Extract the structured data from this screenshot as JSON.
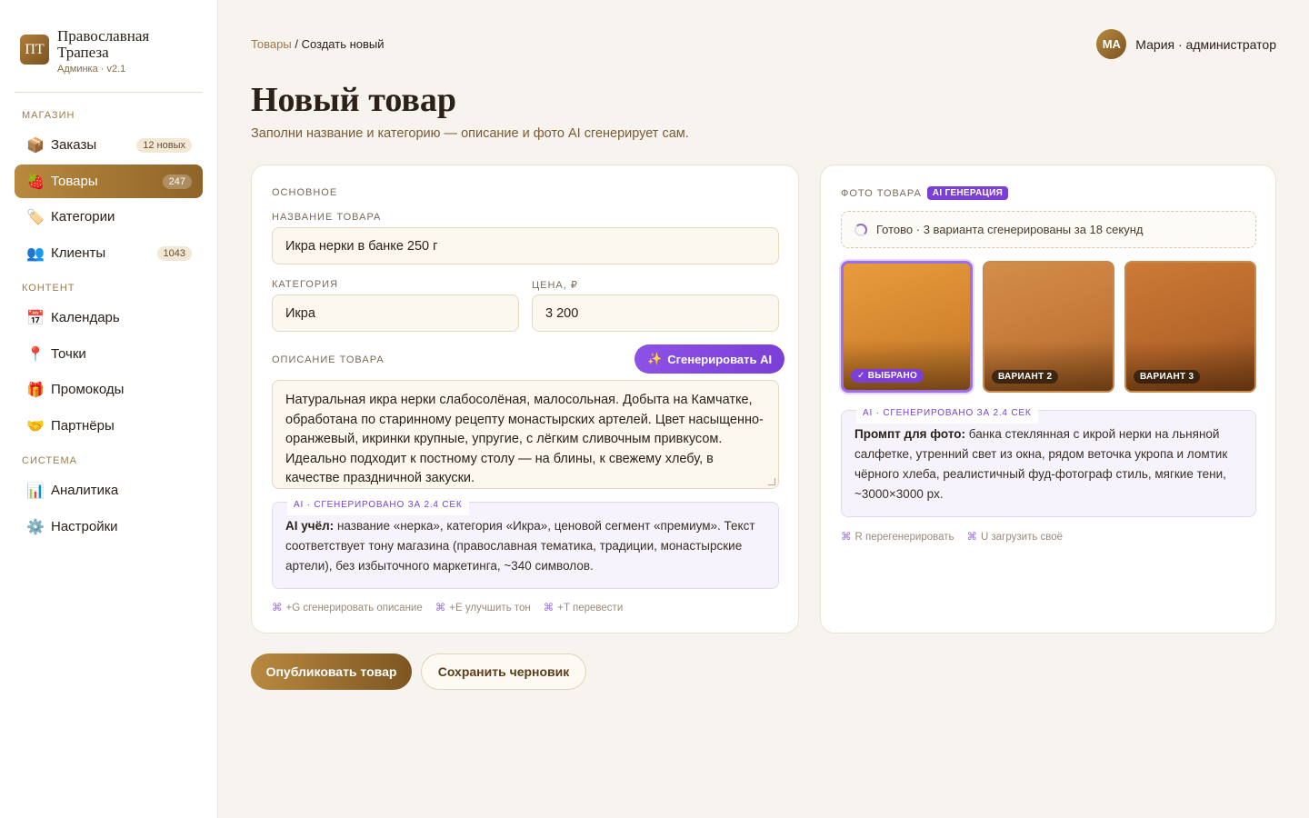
{
  "brand": {
    "logo_text": "ПТ",
    "name": "Православная Трапеза",
    "subtitle": "Админка · v2.1"
  },
  "sidebar": {
    "sections": [
      {
        "title": "Магазин"
      },
      {
        "title": "Контент"
      },
      {
        "title": "Система"
      }
    ],
    "items": [
      {
        "icon": "📦",
        "label": "Заказы",
        "badge": "12 новых"
      },
      {
        "icon": "🍓",
        "label": "Товары",
        "badge": "247",
        "active": true
      },
      {
        "icon": "🏷️",
        "label": "Категории",
        "badge": ""
      },
      {
        "icon": "👥",
        "label": "Клиенты",
        "badge": "1043"
      },
      {
        "icon": "📅",
        "label": "Календарь",
        "badge": ""
      },
      {
        "icon": "📍",
        "label": "Точки",
        "badge": ""
      },
      {
        "icon": "🎁",
        "label": "Промокоды",
        "badge": ""
      },
      {
        "icon": "🤝",
        "label": "Партнёры",
        "badge": ""
      },
      {
        "icon": "📊",
        "label": "Аналитика",
        "badge": ""
      },
      {
        "icon": "⚙️",
        "label": "Настройки",
        "badge": ""
      }
    ]
  },
  "header": {
    "breadcrumb_link": "Товары",
    "breadcrumb_sep": " / ",
    "breadcrumb_current": "Создать новый",
    "user_initials": "МА",
    "user_name": "Мария · администратор"
  },
  "page": {
    "title": "Новый товар",
    "subtitle": "Заполни название и категорию — описание и фото AI сгенерирует сам."
  },
  "form": {
    "section_title": "Основное",
    "name_label": "Название товара",
    "name_value": "Икра нерки в банке 250 г",
    "category_label": "Категория",
    "category_value": "Икра",
    "price_label": "Цена, ₽",
    "price_value": "3 200",
    "description_label": "Описание товара",
    "generate_button": "Сгенерировать AI",
    "description_value": "Натуральная икра нерки слабосолёная, малосольная. Добыта на Камчатке, обработана по старинному рецепту монастырских артелей. Цвет насыщенно-оранжевый, икринки крупные, упругие, с лёгким сливочным привкусом. Идеально подходит к постному столу — на блины, к свежему хлебу, в качестве праздничной закуски.",
    "ai_tag": "AI · сгенерировано за 2.4 сек",
    "ai_note_bold": "AI учёл:",
    "ai_note_text": " название «нерка», категория «Икра», ценовой сегмент «премиум». Текст соответствует тону магазина (православная тематика, традиции, монастырские артели), без избыточного маркетинга, ~340 символов.",
    "shortcuts": [
      {
        "key": "⌘",
        "text": "+G сгенерировать описание"
      },
      {
        "key": "⌘",
        "text": "+E улучшить тон"
      },
      {
        "key": "⌘",
        "text": "+T перевести"
      }
    ]
  },
  "photo": {
    "section_title": "Фото товара",
    "badge": "AI ГЕНЕРАЦИЯ",
    "status": "Готово · 3 варианта сгенерированы за 18 секунд",
    "variants": [
      {
        "label": "✓ ВЫБРАНО",
        "selected": true
      },
      {
        "label": "ВАРИАНТ 2",
        "selected": false
      },
      {
        "label": "ВАРИАНТ 3",
        "selected": false
      }
    ],
    "ai_tag": "AI · сгенерировано за 2.4 сек",
    "prompt_bold": "Промпт для фото:",
    "prompt_text": " банка стеклянная с икрой нерки на льняной салфетке, утренний свет из окна, рядом веточка укропа и ломтик чёрного хлеба, реалистичный фуд-фотограф стиль, мягкие тени, ~3000×3000 px.",
    "shortcuts": [
      {
        "key": "⌘",
        "text": "R перегенерировать"
      },
      {
        "key": "⌘",
        "text": "U загрузить своё"
      }
    ]
  },
  "actions": {
    "publish": "Опубликовать товар",
    "draft": "Сохранить черновик"
  },
  "colors": {
    "accent": "#a57636",
    "ai_purple": "#7b3fd8",
    "background": "#f7f3ee"
  }
}
